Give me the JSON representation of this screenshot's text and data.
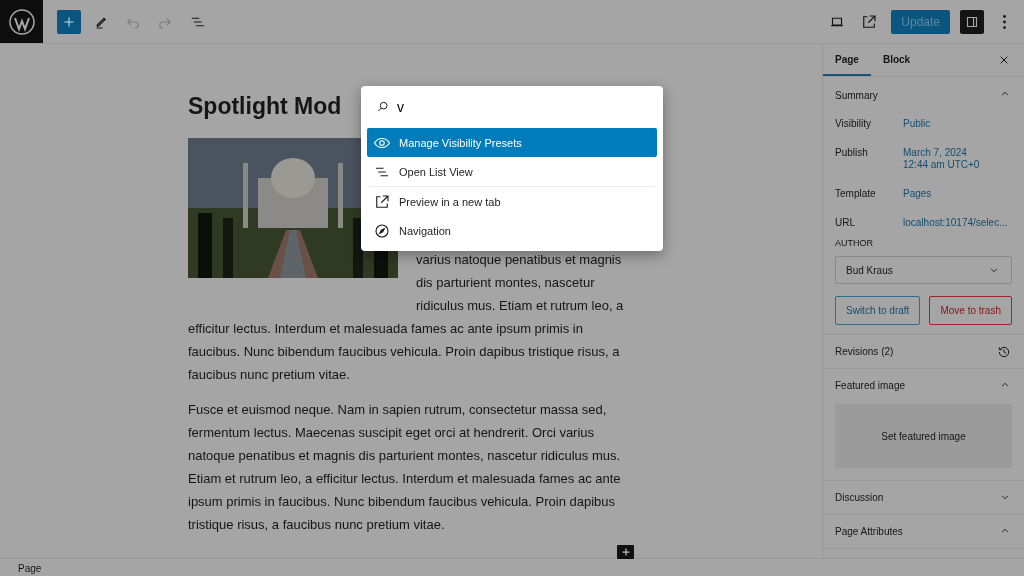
{
  "toolbar": {
    "add_button": {
      "pressed": false
    },
    "undo": {
      "disabled": true
    },
    "redo": {
      "disabled": true
    },
    "update_button": {
      "label": "Update"
    },
    "settings_toggle": {
      "pressed": true
    }
  },
  "editor": {
    "title": "Spotlight Mod",
    "side_text": "varius natoque penatibus et magnis dis parturient montes, nascetur ridiculus mus. Etiam et rutrum leo, a",
    "paragraphs": [
      "efficitur lectus. Interdum et malesuada fames ac ante ipsum primis in faucibus. Nunc bibendum faucibus vehicula. Proin dapibus tristique risus, a faucibus nunc pretium vitae.",
      "Fusce et euismod neque. Nam in sapien rutrum, consectetur massa sed, fermentum lectus. Maecenas suscipit eget orci at hendrerit. Orci varius natoque penatibus et magnis dis parturient montes, nascetur ridiculus mus. Etiam et rutrum leo, a efficitur lectus. Interdum et malesuada fames ac ante ipsum primis in faucibus. Nunc bibendum faucibus vehicula. Proin dapibus tristique risus, a faucibus nunc pretium vitae."
    ]
  },
  "command_palette": {
    "search": {
      "value": "v"
    },
    "groups": [
      [
        {
          "label": "Manage Visibility Presets",
          "kind": "eye",
          "selected": true
        },
        {
          "label": "Open List View",
          "kind": "list",
          "selected": false
        }
      ],
      [
        {
          "label": "Preview in a new tab",
          "kind": "external",
          "selected": false
        },
        {
          "label": "Navigation",
          "kind": "compass",
          "selected": false
        }
      ]
    ]
  },
  "sidebar": {
    "tabs": [
      {
        "label": "Page",
        "selected": true
      },
      {
        "label": "Block",
        "selected": false
      }
    ],
    "summary": {
      "title": "Summary",
      "expanded": true,
      "rows": [
        {
          "label": "Visibility",
          "value": "Public"
        },
        {
          "label": "Publish",
          "value": "March 7, 2024\n12:44 am UTC+0"
        },
        {
          "label": "Template",
          "value": "Pages"
        },
        {
          "label": "URL",
          "value": "localhost:10174/selec..."
        }
      ],
      "author_label": "AUTHOR",
      "author": "Bud Kraus",
      "buttons": [
        {
          "label": "Switch to draft",
          "kind": "secondary"
        },
        {
          "label": "Move to trash",
          "kind": "danger"
        }
      ]
    },
    "panels": [
      {
        "title": "Revisions (2)",
        "kind": "revisions"
      },
      {
        "title": "Featured image",
        "kind": "section",
        "expanded": true,
        "button": "Set featured image"
      },
      {
        "title": "Discussion",
        "kind": "section",
        "expanded": false
      },
      {
        "title": "Page Attributes",
        "kind": "section",
        "expanded": true
      }
    ]
  },
  "status_bar": {
    "breadcrumb": "Page"
  }
}
